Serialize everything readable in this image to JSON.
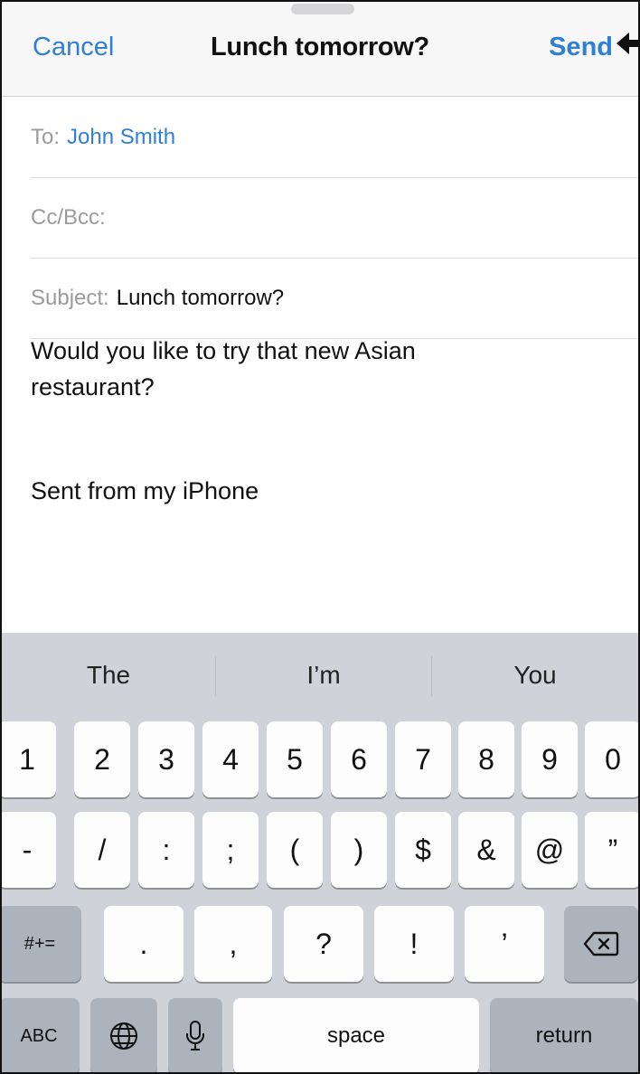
{
  "navbar": {
    "cancel": "Cancel",
    "title": "Lunch tomorrow?",
    "send": "Send"
  },
  "to": {
    "label": "To:",
    "value": "John Smith"
  },
  "ccbcc": {
    "label": "Cc/Bcc:"
  },
  "subject": {
    "label": "Subject:",
    "value": "Lunch tomorrow?"
  },
  "body": {
    "line1": "Would you like to try that new Asian",
    "line2": "restaurant?",
    "signature": "Sent from my iPhone"
  },
  "suggestions": [
    "The",
    "I’m",
    "You"
  ],
  "keys": {
    "row1": [
      "1",
      "2",
      "3",
      "4",
      "5",
      "6",
      "7",
      "8",
      "9",
      "0"
    ],
    "row2": [
      "-",
      "/",
      ":",
      ";",
      "(",
      ")",
      "$",
      "&",
      "@",
      "”"
    ],
    "row3": [
      ".",
      ",",
      "?",
      "!",
      "’"
    ],
    "more_symbols": "#+=",
    "abc": "ABC",
    "space": "space",
    "return": "return",
    "icons": {
      "globe": "globe-icon",
      "mic": "microphone-icon",
      "backspace": "backspace-icon"
    }
  },
  "colors": {
    "accent": "#2f7fd6",
    "keyboard_bg": "#cfd3d9",
    "nav_bg": "#f7f7f7"
  }
}
